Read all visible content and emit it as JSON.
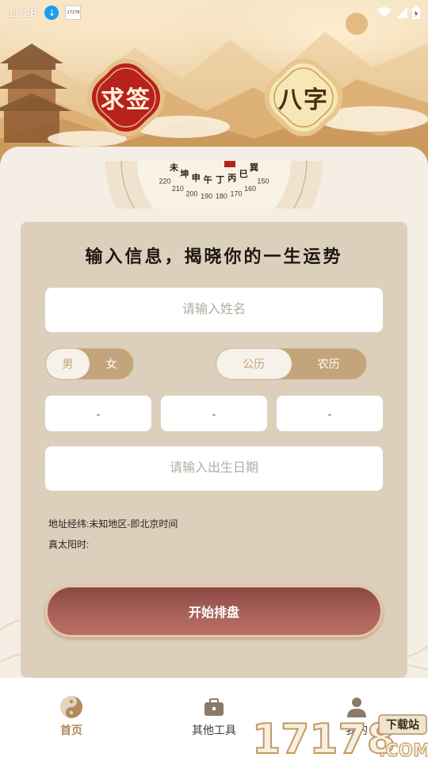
{
  "status_bar": {
    "time": "11:28",
    "notification_thumb": "17178"
  },
  "top_buttons": {
    "qiuqian": "求签",
    "bazi": "八字"
  },
  "compass": {
    "numbers": [
      "220",
      "210",
      "200",
      "190",
      "180",
      "170",
      "160",
      "150"
    ],
    "glyphs": [
      "未",
      "坤",
      "申",
      "午",
      "丁",
      "丙",
      "巳",
      "巽"
    ]
  },
  "form": {
    "title": "输入信息，揭晓你的一生运势",
    "name_placeholder": "请输入姓名",
    "gender": {
      "male": "男",
      "female": "女",
      "selected": "男"
    },
    "calendar": {
      "solar": "公历",
      "lunar": "农历",
      "selected": "公历"
    },
    "pickers": [
      "-",
      "-",
      "-"
    ],
    "birth_date_placeholder": "请输入出生日期",
    "location_line": "地址经纬:未知地区-即北京时间",
    "true_solar_time": "真太阳时:",
    "start_button": "开始排盘"
  },
  "bottom_nav": [
    {
      "label": "首页",
      "icon": "yin-yang-icon",
      "active": true
    },
    {
      "label": "其他工具",
      "icon": "toolbox-icon",
      "active": false
    },
    {
      "label": "我的",
      "icon": "person-icon",
      "active": false
    }
  ],
  "watermark": {
    "text": "17178",
    "suffix": ".COM",
    "tag": "下载站"
  },
  "colors": {
    "card_bg": "#dcd0bd",
    "accent_brown": "#c4a57b",
    "start_button": "#a9625a",
    "active_nav": "#b08a5e"
  }
}
